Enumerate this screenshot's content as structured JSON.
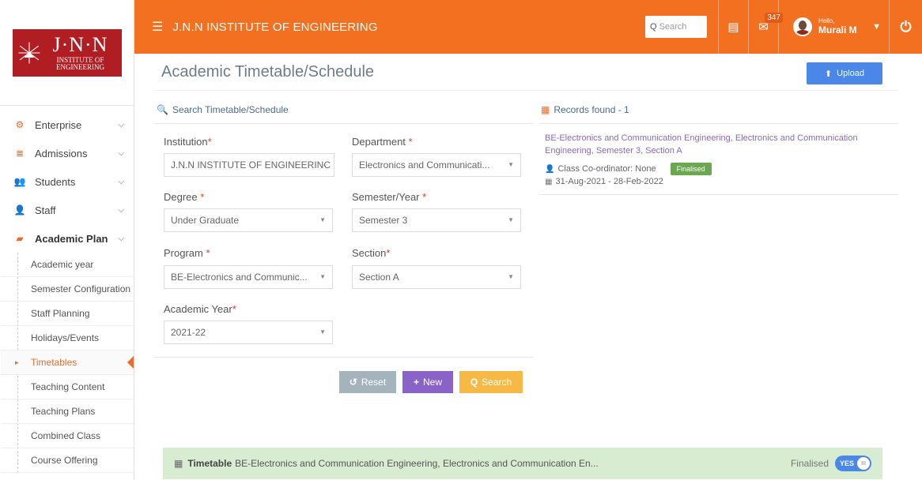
{
  "brand": {
    "logo_big": "J·N·N",
    "logo_small": "INSTITUTE OF ENGINEERING",
    "title": "J.N.N INSTITUTE OF ENGINEERING",
    "accent": "#f37021"
  },
  "topbar": {
    "search_placeholder": "Search",
    "messages_count": "347",
    "greeting": "Hello,",
    "user_name": "Murali M"
  },
  "sidebar": {
    "items": [
      {
        "label": "Enterprise",
        "icon": "cogs-icon"
      },
      {
        "label": "Admissions",
        "icon": "list-icon"
      },
      {
        "label": "Students",
        "icon": "users-icon"
      },
      {
        "label": "Staff",
        "icon": "user-icon"
      },
      {
        "label": "Academic Plan",
        "icon": "book-icon"
      }
    ],
    "sub_items": [
      "Academic year",
      "Semester Configuration",
      "Staff Planning",
      "Holidays/Events",
      "Timetables",
      "Teaching Content",
      "Teaching Plans",
      "Combined Class",
      "Course Offering"
    ]
  },
  "page": {
    "title": "Academic Timetable/Schedule",
    "upload_label": "Upload"
  },
  "search_panel": {
    "heading": "Search Timetable/Schedule",
    "fields": {
      "institution": {
        "label": "Institution",
        "value": "J.N.N INSTITUTE OF ENGINEERINC"
      },
      "department": {
        "label": "Department ",
        "value": "Electronics and Communicati..."
      },
      "degree": {
        "label": "Degree ",
        "value": "Under Graduate"
      },
      "semester": {
        "label": "Semester/Year ",
        "value": "Semester 3"
      },
      "program": {
        "label": "Program ",
        "value": "BE-Electronics and Communic..."
      },
      "section": {
        "label": "Section",
        "value": "Section A"
      },
      "academic_year": {
        "label": "Academic Year",
        "value": "2021-22"
      }
    },
    "buttons": {
      "reset": "Reset",
      "new": "New",
      "search": "Search"
    }
  },
  "records": {
    "heading": "Records found - 1",
    "item": {
      "title": "BE-Electronics and Communication Engineering, Electronics and Communication Engineering, Semester 3, Section A",
      "coordinator": "Class Co-ordinator: None",
      "status": "Finalised",
      "dates": "31-Aug-2021 - 28-Feb-2022"
    }
  },
  "footer": {
    "label": "Timetable",
    "text": "BE-Electronics and Communication Engineering, Electronics and Communication En...",
    "status_label": "Finalised",
    "toggle": "YES",
    "toggle_knob": "III"
  }
}
